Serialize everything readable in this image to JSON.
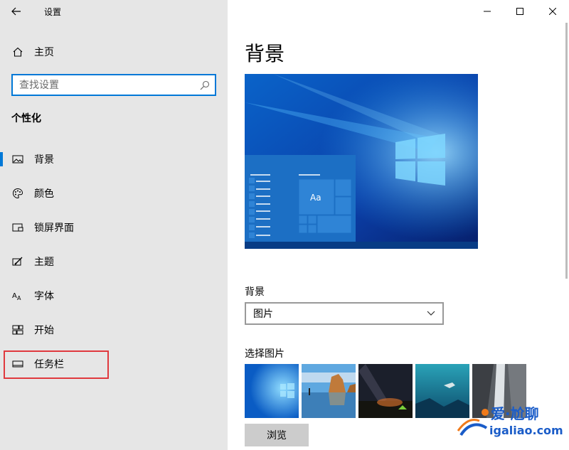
{
  "window": {
    "title": "设置"
  },
  "sidebar": {
    "home_label": "主页",
    "search_placeholder": "查找设置",
    "section_title": "个性化",
    "items": [
      {
        "label": "背景",
        "icon": "picture-icon",
        "active": true
      },
      {
        "label": "颜色",
        "icon": "palette-icon",
        "active": false
      },
      {
        "label": "锁屏界面",
        "icon": "lock-screen-icon",
        "active": false
      },
      {
        "label": "主题",
        "icon": "theme-brush-icon",
        "active": false
      },
      {
        "label": "字体",
        "icon": "font-icon",
        "active": false
      },
      {
        "label": "开始",
        "icon": "start-tiles-icon",
        "active": false
      },
      {
        "label": "任务栏",
        "icon": "taskbar-icon",
        "active": false
      }
    ]
  },
  "main": {
    "title": "背景",
    "preview_tile_text": "Aa",
    "background_label": "背景",
    "background_value": "图片",
    "choose_picture_label": "选择图片",
    "browse_label": "浏览"
  },
  "watermark": {
    "line1": "爱·尬聊",
    "line2": "igaliao.com"
  },
  "colors": {
    "accent": "#0078d7",
    "sidebar_bg": "#e6e6e6",
    "highlight": "#e0393e"
  }
}
